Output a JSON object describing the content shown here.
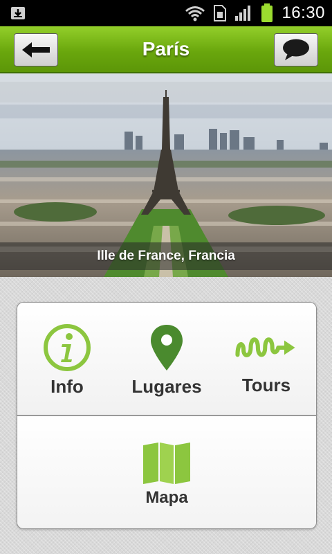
{
  "status_bar": {
    "time": "16:30",
    "icons": [
      "download-icon",
      "wifi-icon",
      "sim-icon",
      "signal-icon",
      "battery-icon"
    ]
  },
  "header": {
    "title": "París",
    "back_icon": "arrow-left-icon",
    "chat_icon": "speech-bubble-icon",
    "color": "#7ab51d"
  },
  "hero": {
    "caption": "Ille de France, Francia"
  },
  "menu": {
    "items": [
      {
        "label": "Info",
        "icon": "info-icon"
      },
      {
        "label": "Lugares",
        "icon": "map-pin-icon"
      },
      {
        "label": "Tours",
        "icon": "route-arrow-icon"
      }
    ],
    "map": {
      "label": "Mapa",
      "icon": "folded-map-icon"
    },
    "accent": "#8cc63f"
  }
}
